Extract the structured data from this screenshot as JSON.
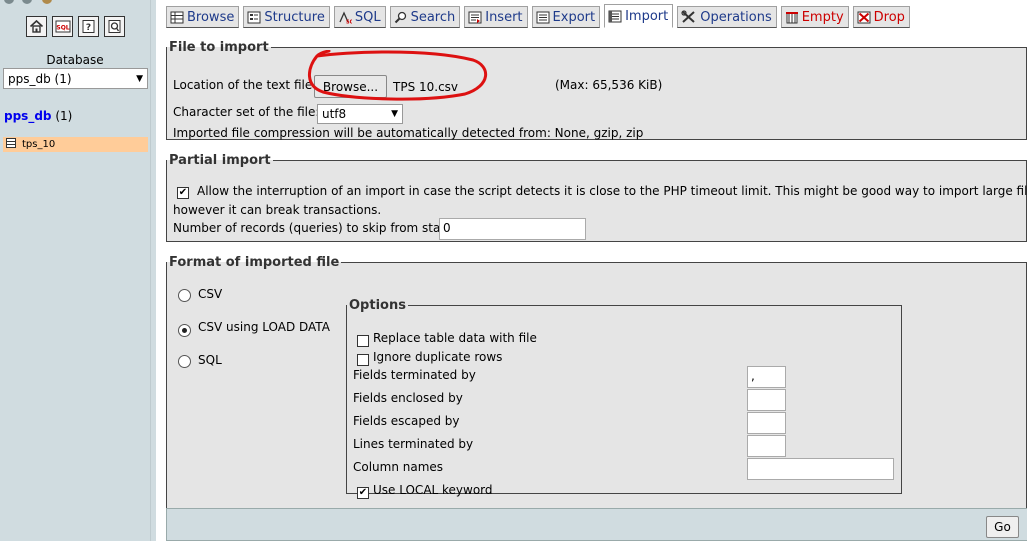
{
  "sidebar": {
    "icons": [
      "home-icon",
      "sql-query-icon",
      "help-icon",
      "sql-window-icon"
    ],
    "database_label": "Database",
    "database_selected": "pps_db (1)",
    "db_name": "pps_db",
    "db_count": "(1)",
    "table_name": "tps_10"
  },
  "tabs": [
    {
      "label": "Browse",
      "icon": "browse-icon"
    },
    {
      "label": "Structure",
      "icon": "structure-icon"
    },
    {
      "label": "SQL",
      "icon": "sql-icon"
    },
    {
      "label": "Search",
      "icon": "search-icon"
    },
    {
      "label": "Insert",
      "icon": "insert-icon"
    },
    {
      "label": "Export",
      "icon": "export-icon"
    },
    {
      "label": "Import",
      "icon": "import-icon",
      "active": true
    },
    {
      "label": "Operations",
      "icon": "operations-icon"
    },
    {
      "label": "Empty",
      "icon": "empty-icon",
      "danger": true
    },
    {
      "label": "Drop",
      "icon": "drop-icon",
      "danger": true
    }
  ],
  "file_to_import": {
    "legend": "File to import",
    "location_label": "Location of the text file",
    "browse_label": "Browse...",
    "file_name": "TPS 10.csv",
    "max_size": "(Max: 65,536 KiB)",
    "charset_label": "Character set of the file:",
    "charset_value": "utf8",
    "compression_note": "Imported file compression will be automatically detected from: None, gzip, zip"
  },
  "partial_import": {
    "legend": "Partial import",
    "allow_interrupt_checked": true,
    "allow_interrupt_line1": "Allow the interruption of an import in case the script detects it is close to the PHP timeout limit. This might be good way to import large files,",
    "allow_interrupt_line2": "however it can break transactions.",
    "skip_label": "Number of records (queries) to skip from start",
    "skip_value": "0"
  },
  "format": {
    "legend": "Format of imported file",
    "options": [
      {
        "label": "CSV",
        "selected": false
      },
      {
        "label": "CSV using LOAD DATA",
        "selected": true
      },
      {
        "label": "SQL",
        "selected": false
      }
    ]
  },
  "options": {
    "legend": "Options",
    "replace_label": "Replace table data with file",
    "replace_checked": false,
    "ignore_label": "Ignore duplicate rows",
    "ignore_checked": false,
    "fields_terminated_label": "Fields terminated by",
    "fields_terminated_value": ",",
    "fields_enclosed_label": "Fields enclosed by",
    "fields_enclosed_value": "",
    "fields_escaped_label": "Fields escaped by",
    "fields_escaped_value": "",
    "lines_terminated_label": "Lines terminated by",
    "lines_terminated_value": "",
    "column_names_label": "Column names",
    "column_names_value": "",
    "use_local_label": "Use LOCAL keyword",
    "use_local_checked": true
  },
  "go_label": "Go",
  "colors": {
    "sidebar_bg": "#d0dce0",
    "panel_bg": "#e5e5e5",
    "link": "#0000ee",
    "danger": "#cc0000",
    "highlight": "#ffcc99",
    "annotation": "#dd1111"
  }
}
